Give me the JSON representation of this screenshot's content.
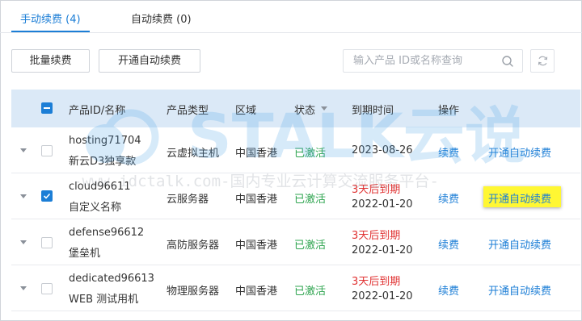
{
  "tabs": [
    {
      "label": "手动续费 (4)",
      "active": true
    },
    {
      "label": "自动续费 (0)",
      "active": false
    }
  ],
  "toolbar": {
    "batch_renew_label": "批量续费",
    "enable_auto_renew_label": "开通自动续费",
    "search_placeholder": "输入产品 ID或名称查询"
  },
  "table": {
    "headers": {
      "product": "产品ID/名称",
      "type": "产品类型",
      "region": "区域",
      "status": "状态",
      "expiry": "到期时间",
      "actions": "操作"
    },
    "rows": [
      {
        "id": "hosting71704",
        "name": "新云D3独享款",
        "type": "云虚拟主机",
        "region": "中国香港",
        "status": "已激活",
        "expiry_note": "",
        "expiry_date": "2023-08-26",
        "renew": "续费",
        "auto_renew": "开通自动续费",
        "checked": false
      },
      {
        "id": "cloud96611",
        "name": "自定义名称",
        "type": "云服务器",
        "region": "中国香港",
        "status": "已激活",
        "expiry_note": "3天后到期",
        "expiry_date": "2022-01-20",
        "renew": "续费",
        "auto_renew": "开通自动续费",
        "checked": true
      },
      {
        "id": "defense96612",
        "name": "堡垒机",
        "type": "高防服务器",
        "region": "中国香港",
        "status": "已激活",
        "expiry_note": "3天后到期",
        "expiry_date": "2022-01-20",
        "renew": "续费",
        "auto_renew": "开通自动续费",
        "checked": false
      },
      {
        "id": "dedicated96613",
        "name": "WEB 测试用机",
        "type": "物理服务器",
        "region": "中国香港",
        "status": "已激活",
        "expiry_note": "3天后到期",
        "expiry_date": "2022-01-20",
        "renew": "续费",
        "auto_renew": "开通自动续费",
        "checked": false
      }
    ]
  },
  "watermark": {
    "logo_text": "STALK云说",
    "url_text": "-www.idctalk.com-国内专业云计算交流服务平台-"
  },
  "colors": {
    "accent": "#1c7ed6",
    "header_bg": "#dbe9f7",
    "status_green": "#2ea44f",
    "warning_red": "#e03131",
    "highlight_yellow": "#fff733"
  }
}
